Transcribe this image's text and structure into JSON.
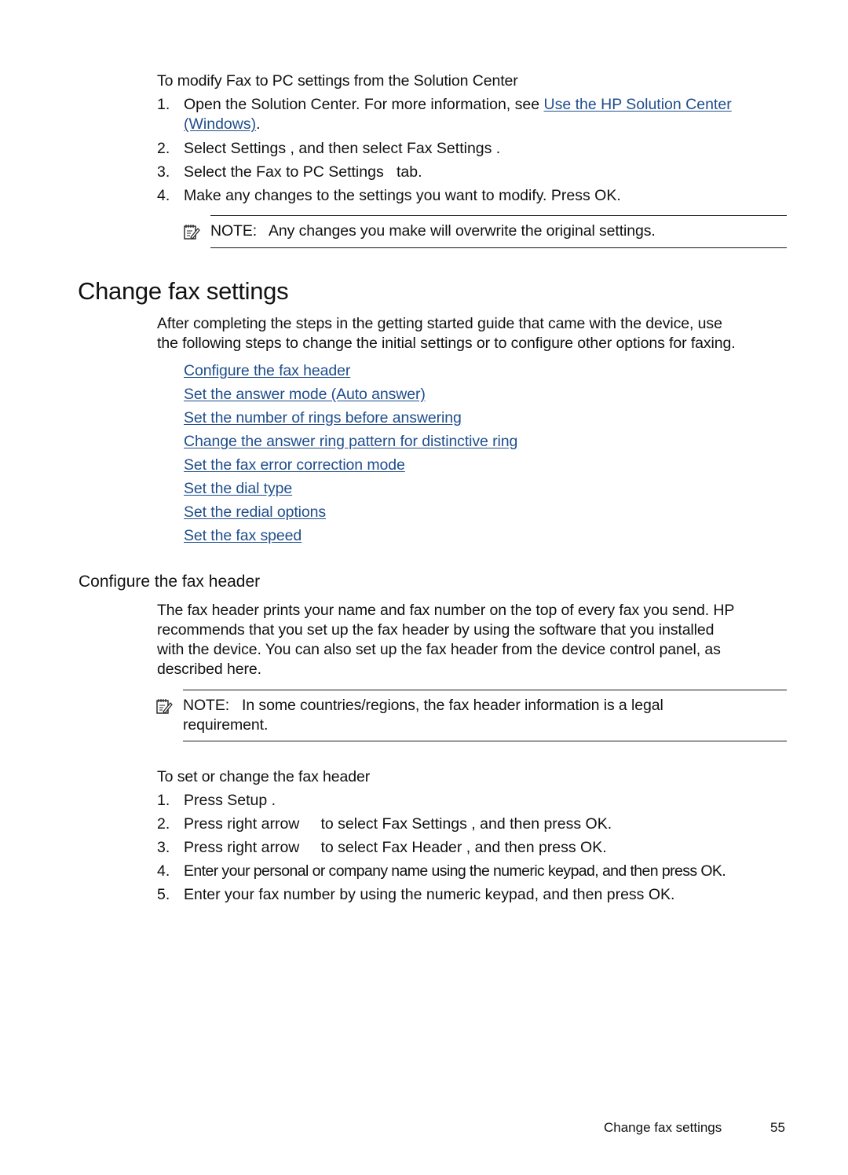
{
  "section1": {
    "intro": "To modify Fax to PC settings from the Solution Center",
    "steps": [
      {
        "num": "1.",
        "text_before": "Open the Solution Center. For more information, see ",
        "link_line1": "Use the HP Solution Center",
        "link_line2": "(Windows)",
        "text_after": "."
      },
      {
        "num": "2.",
        "text": "Select Settings , and then select Fax Settings ."
      },
      {
        "num": "3.",
        "text": "Select the Fax to PC Settings   tab."
      },
      {
        "num": "4.",
        "text": "Make any changes to the settings you want to modify. Press OK."
      }
    ],
    "note": "NOTE:   Any changes you make will overwrite the original settings."
  },
  "main": {
    "title": "Change fax settings",
    "intro_line1": "After completing the steps in the getting started guide that came with the device, use",
    "intro_line2": "the following steps to change the initial settings or to configure other options for faxing.",
    "links": [
      "Configure the fax header",
      "Set the answer mode (Auto answer)",
      "Set the number of rings before answering",
      "Change the answer ring pattern for distinctive ring",
      "Set the fax error correction mode",
      "Set the dial type",
      "Set the redial options",
      "Set the fax speed"
    ]
  },
  "fax_header": {
    "heading": "Configure the fax header",
    "para": [
      "The fax header prints your name and fax number on the top of every fax you send. HP",
      "recommends that you set up the fax header by using the software that you installed",
      "with the device. You can also set up the fax header from the device control panel, as",
      "described here."
    ],
    "note_line1": "NOTE:   In some countries/regions, the fax header information is a legal",
    "note_line2": "requirement.",
    "procedure_title": "To set or change the fax header",
    "steps": [
      {
        "num": "1.",
        "text": "Press Setup ."
      },
      {
        "num": "2.",
        "text": "Press right arrow     to select Fax Settings , and then press OK."
      },
      {
        "num": "3.",
        "text": "Press right arrow     to select Fax Header , and then press OK."
      },
      {
        "num": "4.",
        "text": "Enter your personal or company name using the numeric keypad, and then press OK."
      },
      {
        "num": "5.",
        "text": "Enter your fax number by using the numeric keypad, and then press OK."
      }
    ]
  },
  "footer": {
    "section": "Change fax settings",
    "page": "55"
  },
  "colors": {
    "link": "#1f4e8c",
    "text": "#111111",
    "rule": "#1a1a1a"
  }
}
